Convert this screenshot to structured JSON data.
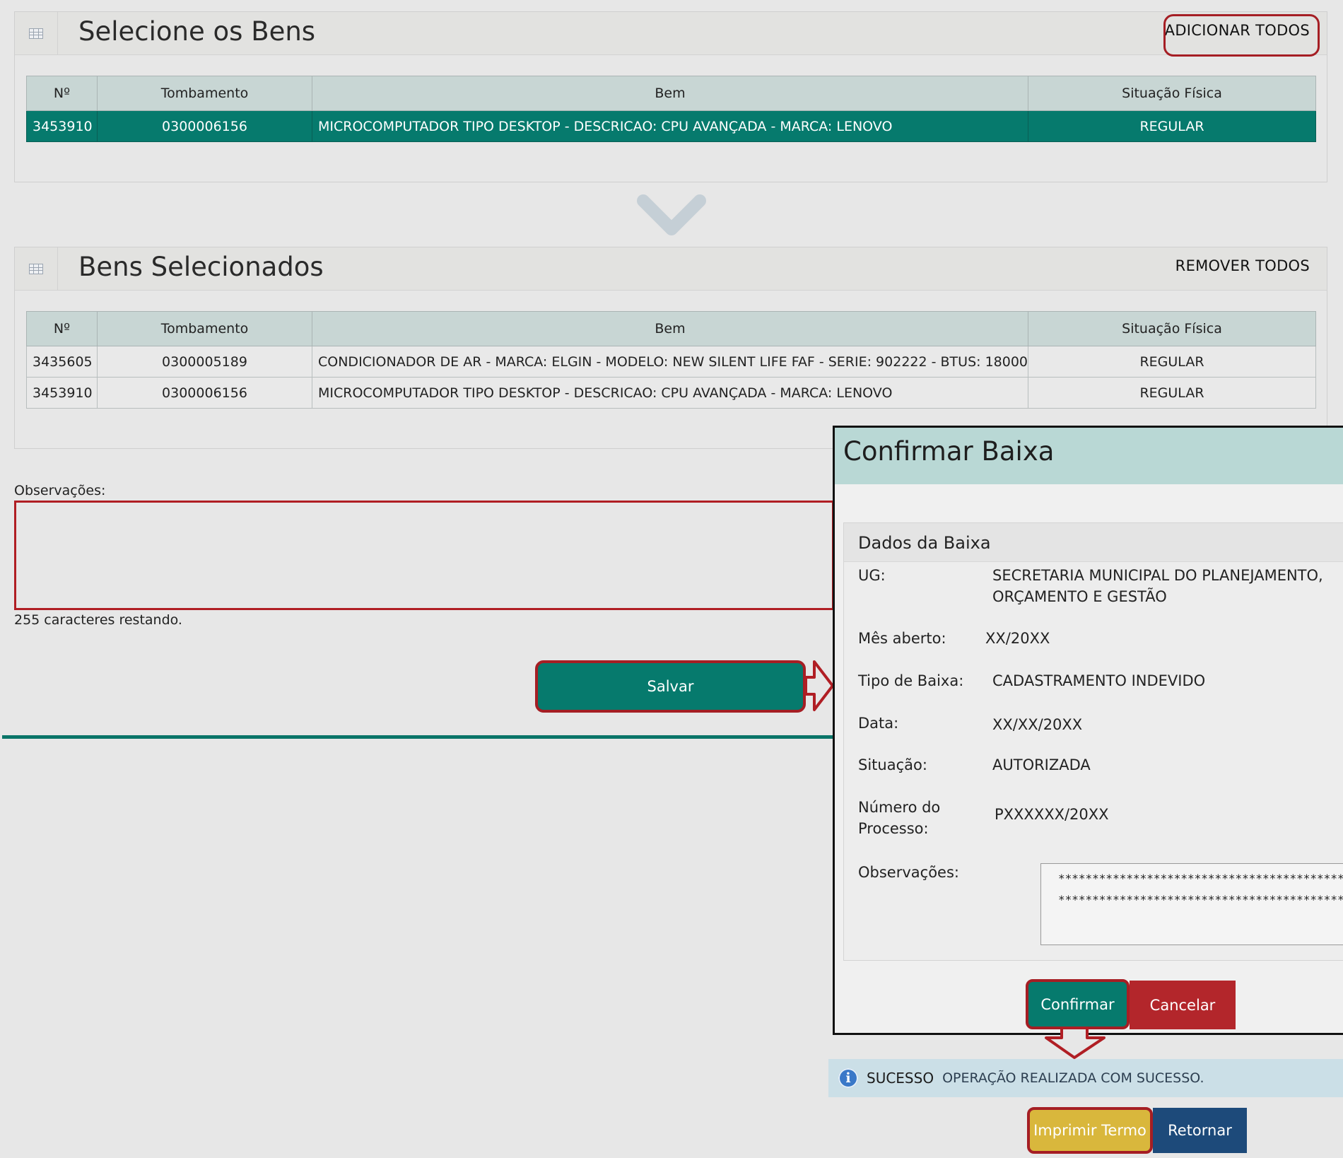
{
  "select_panel": {
    "title": "Selecione os Bens",
    "action": "ADICIONAR TODOS",
    "headers": [
      "Nº",
      "Tombamento",
      "Bem",
      "Situação Física"
    ],
    "rows": [
      {
        "n": "3453910",
        "tomb": "0300006156",
        "bem": "MICROCOMPUTADOR TIPO DESKTOP - DESCRICAO: CPU AVANÇADA - MARCA: LENOVO",
        "sit": "REGULAR"
      }
    ]
  },
  "selected_panel": {
    "title": "Bens Selecionados",
    "action": "REMOVER TODOS",
    "headers": [
      "Nº",
      "Tombamento",
      "Bem",
      "Situação Física"
    ],
    "rows": [
      {
        "n": "3435605",
        "tomb": "0300005189",
        "bem": "CONDICIONADOR DE AR - MARCA: ELGIN - MODELO: NEW SILENT LIFE FAF - SERIE: 902222 - BTUS: 18000",
        "sit": "REGULAR"
      },
      {
        "n": "3453910",
        "tomb": "0300006156",
        "bem": "MICROCOMPUTADOR TIPO DESKTOP - DESCRICAO: CPU AVANÇADA - MARCA: LENOVO",
        "sit": "REGULAR"
      }
    ]
  },
  "form": {
    "obs_label": "Observações:",
    "obs_value": "",
    "remaining": "255 caracteres restando.",
    "save_label": "Salvar"
  },
  "modal": {
    "title": "Confirmar Baixa",
    "section_title": "Dados da Baixa",
    "ug_label": "UG:",
    "ug_line1": "SECRETARIA MUNICIPAL DO PLANEJAMENTO,",
    "ug_line2": "ORÇAMENTO E GESTÃO",
    "mes_label": "Mês aberto:",
    "mes_value": "XX/20XX",
    "tipo_label": "Tipo de Baixa:",
    "tipo_value": "CADASTRAMENTO INDEVIDO",
    "data_label": "Data:",
    "data_value": "XX/XX/20XX",
    "sit_label": "Situação:",
    "sit_value": "AUTORIZADA",
    "proc_label1": "Número do",
    "proc_label2": "Processo:",
    "proc_value": "PXXXXXX/20XX",
    "obs_label": "Observações:",
    "obs_line1": "********************************************",
    "obs_line2": "********************************************",
    "confirm_label": "Confirmar",
    "cancel_label": "Cancelar"
  },
  "result": {
    "status": "SUCESSO",
    "message": "OPERAÇÃO REALIZADA COM SUCESSO.",
    "print_label": "Imprimir Termo",
    "return_label": "Retornar"
  },
  "colors": {
    "teal": "#067a6d",
    "cancel_red": "#b3262b",
    "print_yellow": "#d9b73c",
    "return_navy": "#1d4a7a",
    "highlight_red": "#a51e24"
  }
}
